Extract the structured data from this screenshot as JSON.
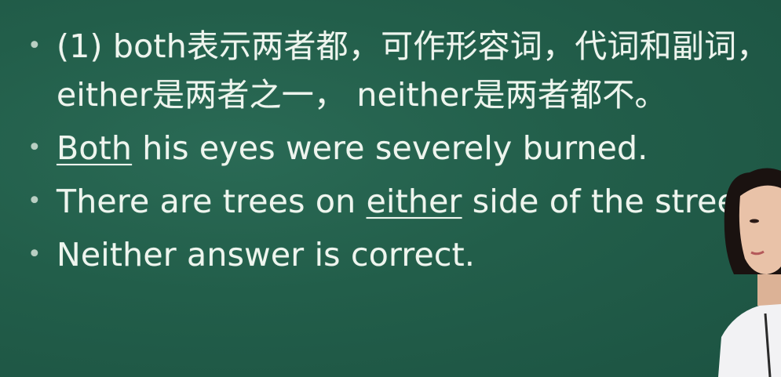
{
  "bullets": [
    {
      "parts": [
        {
          "text": "(1) both表示两者都，可作形容词，代词和副词，either是两者之一， neither是两者都不。",
          "underline": false
        }
      ]
    },
    {
      "parts": [
        {
          "text": "Both",
          "underline": true
        },
        {
          "text": " his eyes were severely burned.",
          "underline": false
        }
      ]
    },
    {
      "parts": [
        {
          "text": "There are trees on ",
          "underline": false
        },
        {
          "text": "either",
          "underline": true
        },
        {
          "text": " side of the street.",
          "underline": false
        }
      ]
    },
    {
      "parts": [
        {
          "text": "Neither answer is correct.",
          "underline": false
        }
      ]
    }
  ],
  "bullet_glyph": "•"
}
